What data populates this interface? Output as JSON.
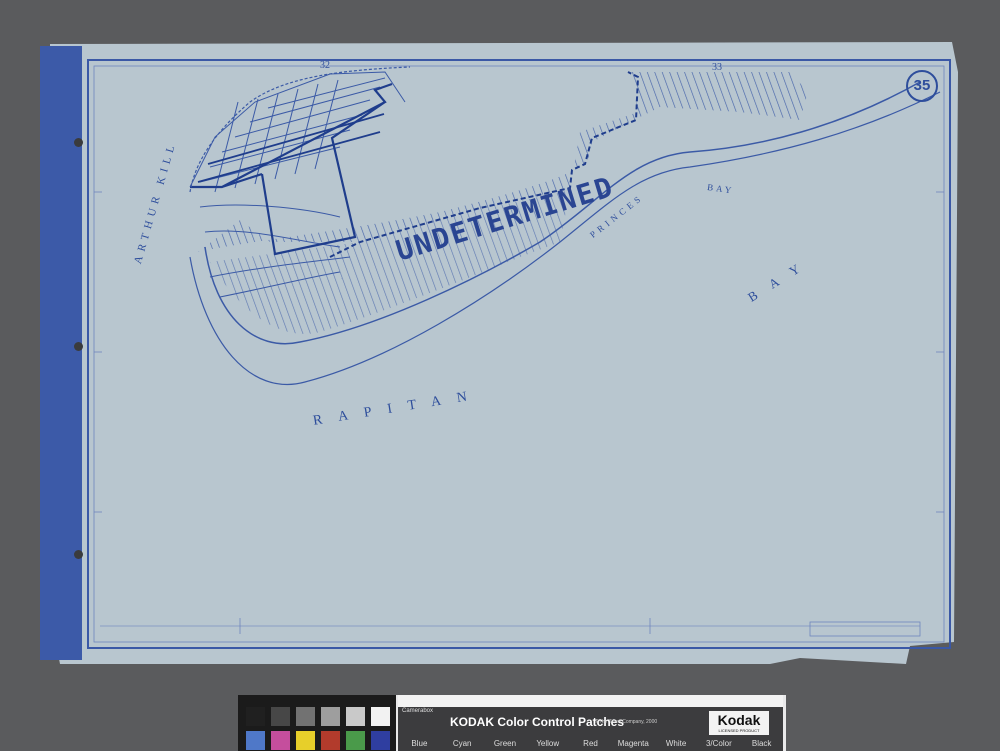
{
  "map": {
    "sheet_number": "35",
    "section_numbers": [
      "32",
      "33"
    ],
    "undetermined_label": "UNDETERMINED",
    "water_labels": {
      "arthur_kill": "ARTHUR KILL",
      "raritan": "RAPITAN",
      "bay_large": "BAY",
      "princes": "PRINCES",
      "princes_bay": "BAY"
    },
    "colors": {
      "paper": "#b8c6cf",
      "ink": "#2e4e9c",
      "binding": "#3c5aa8",
      "background": "#5a5b5d"
    }
  },
  "target": {
    "title": "KODAK Color Control Patches",
    "copyright": "©The Tiffen Company, 2000",
    "camerabox": "Camerabox",
    "brand": "Kodak",
    "brand_sub": "LICENSED PRODUCT",
    "labels": [
      "Blue",
      "Cyan",
      "Green",
      "Yellow",
      "Red",
      "Magenta",
      "White",
      "3/Color",
      "Black"
    ],
    "patch_colors": [
      "#202020",
      "#474747",
      "#727272",
      "#9e9e9e",
      "#c9c9c9",
      "#f2f2f2",
      "#4f78c8",
      "#c54e9d",
      "#e7cf2a",
      "#b23b2c",
      "#4a9a4a",
      "#2f3ea0"
    ]
  }
}
